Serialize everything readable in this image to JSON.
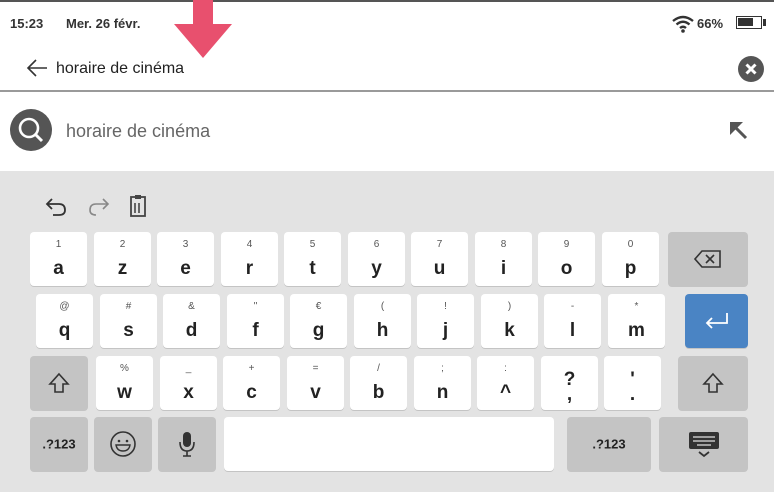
{
  "status_bar": {
    "time": "15:23",
    "date": "Mer. 26 févr.",
    "battery": "66%",
    "icons": [
      "wifi-icon",
      "battery-icon"
    ]
  },
  "search": {
    "query": "horaire de cinéma",
    "icons": [
      "back-arrow-icon",
      "clear-icon"
    ]
  },
  "suggestion": {
    "text": "horaire de cinéma",
    "icons": [
      "search-icon",
      "fill-query-arrow-icon"
    ]
  },
  "keyboard": {
    "toolbar_icons": [
      "undo-icon",
      "redo-icon",
      "clipboard-icon"
    ],
    "row1": [
      {
        "hint": "1",
        "main": "a"
      },
      {
        "hint": "2",
        "main": "z"
      },
      {
        "hint": "3",
        "main": "e"
      },
      {
        "hint": "4",
        "main": "r"
      },
      {
        "hint": "5",
        "main": "t"
      },
      {
        "hint": "6",
        "main": "y"
      },
      {
        "hint": "7",
        "main": "u"
      },
      {
        "hint": "8",
        "main": "i"
      },
      {
        "hint": "9",
        "main": "o"
      },
      {
        "hint": "0",
        "main": "p"
      }
    ],
    "row2": [
      {
        "hint": "@",
        "main": "q"
      },
      {
        "hint": "#",
        "main": "s"
      },
      {
        "hint": "&",
        "main": "d"
      },
      {
        "hint": "\"",
        "main": "f"
      },
      {
        "hint": "€",
        "main": "g"
      },
      {
        "hint": "(",
        "main": "h"
      },
      {
        "hint": "!",
        "main": "j"
      },
      {
        "hint": ")",
        "main": "k"
      },
      {
        "hint": "-",
        "main": "l"
      },
      {
        "hint": "*",
        "main": "m"
      }
    ],
    "row3": [
      {
        "hint": "%",
        "main": "w"
      },
      {
        "hint": "_",
        "main": "x"
      },
      {
        "hint": "+",
        "main": "c"
      },
      {
        "hint": "=",
        "main": "v"
      },
      {
        "hint": "/",
        "main": "b"
      },
      {
        "hint": ";",
        "main": "n"
      },
      {
        "hint": ":",
        "main": "^"
      },
      {
        "hint": "",
        "main": "?\n,"
      },
      {
        "hint": "",
        "main": "'\n."
      }
    ],
    "symbols_left": ".?123",
    "symbols_right": ".?123",
    "special_icons": [
      "backspace-icon",
      "enter-icon",
      "shift-icon",
      "emoji-icon",
      "microphone-icon",
      "hide-keyboard-icon"
    ]
  },
  "colors": {
    "accent": "#4a84c4",
    "annotation_arrow": "#e8506e",
    "keyboard_bg": "#e3e3e3",
    "dark_key": "#c4c4c4"
  }
}
